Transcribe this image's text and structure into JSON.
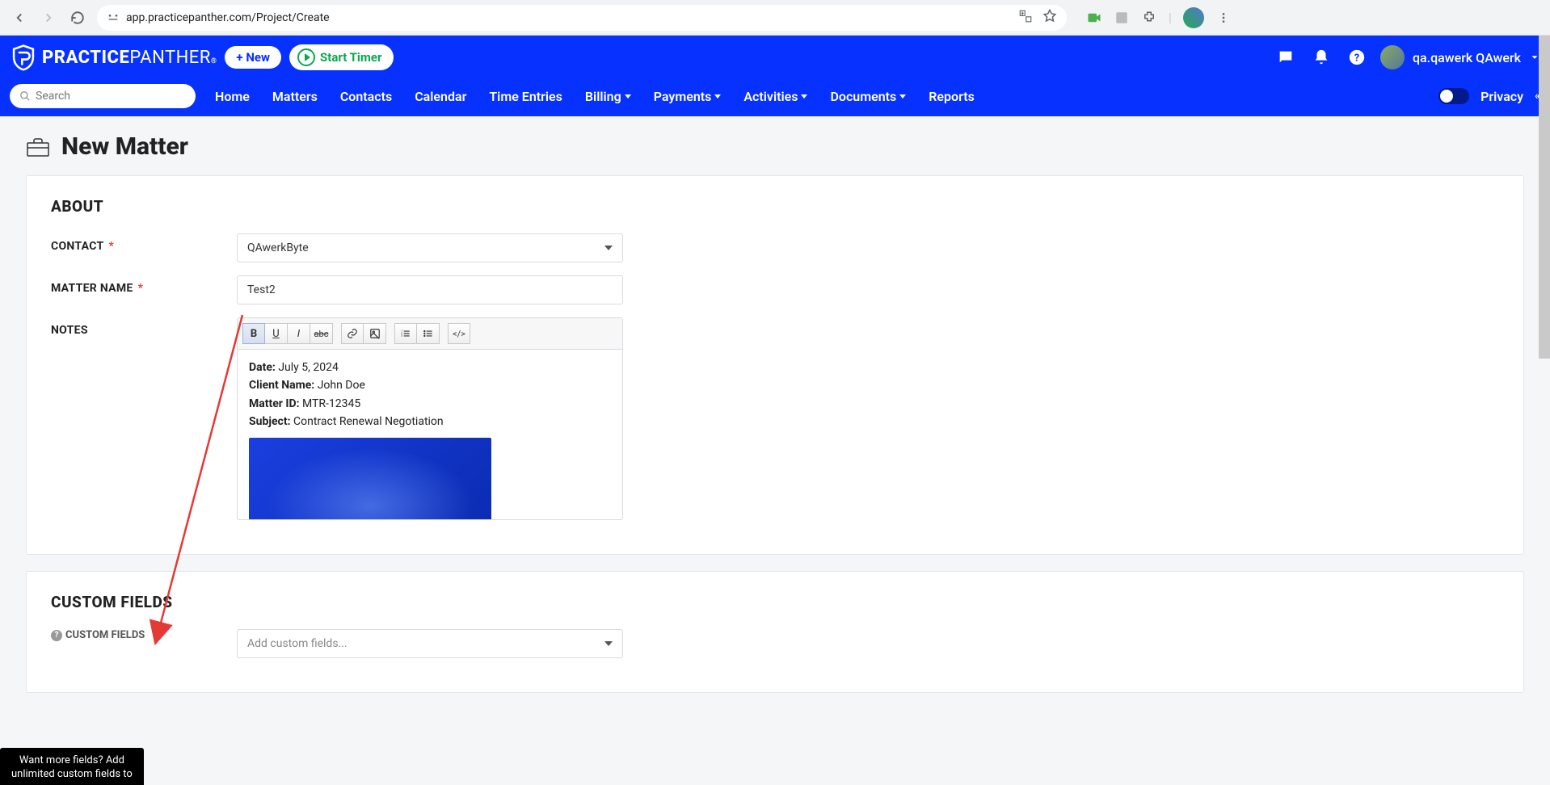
{
  "browser": {
    "url": "app.practicepanther.com/Project/Create"
  },
  "header": {
    "brand_bold": "PRACTICE",
    "brand_light": "PANTHER",
    "new_button": "+ New",
    "timer_button": "Start Timer",
    "user_name": "qa.qawerk QAwerk"
  },
  "nav": {
    "search_placeholder": "Search",
    "items": [
      "Home",
      "Matters",
      "Contacts",
      "Calendar",
      "Time Entries",
      "Billing",
      "Payments",
      "Activities",
      "Documents",
      "Reports"
    ],
    "dropdown_flags": [
      false,
      false,
      false,
      false,
      false,
      true,
      true,
      true,
      true,
      false
    ],
    "privacy": "Privacy"
  },
  "page": {
    "title": "New Matter"
  },
  "about": {
    "section_title": "ABOUT",
    "contact_label": "CONTACT",
    "contact_value": "QAwerkByte",
    "matter_name_label": "MATTER NAME",
    "matter_name_value": "Test2",
    "notes_label": "NOTES",
    "notes": {
      "date_label": "Date:",
      "date_value": "July 5, 2024",
      "client_label": "Client Name:",
      "client_value": "John Doe",
      "matterid_label": "Matter ID:",
      "matterid_value": "MTR-12345",
      "subject_label": "Subject:",
      "subject_value": "Contract Renewal Negotiation"
    }
  },
  "custom_fields": {
    "section_title": "CUSTOM FIELDS",
    "sub_label": "CUSTOM FIELDS",
    "placeholder": "Add custom fields..."
  },
  "tooltip": {
    "line1": "Want more fields? Add",
    "line2": "unlimited custom fields to"
  }
}
